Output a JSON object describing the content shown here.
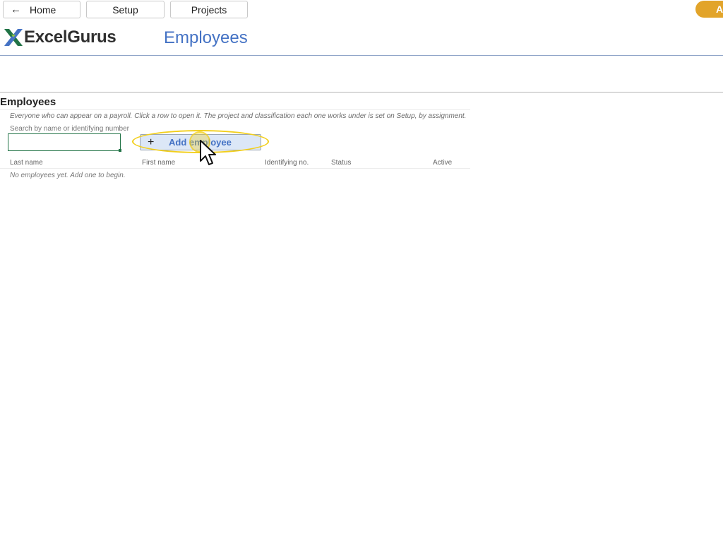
{
  "nav": {
    "home_label": "Home",
    "home_icon": "arrow-left-icon",
    "setup_label": "Setup",
    "projects_label": "Projects",
    "account_initial": "A"
  },
  "header": {
    "logo_text": "ExcelGurus",
    "page_title": "Employees"
  },
  "section": {
    "title": "Employees",
    "description": "Everyone who can appear on a payroll. Click a row to open it. The project and classification each one works under is set on Setup, by assignment.",
    "search_label": "Search by name or identifying number",
    "search_value": "",
    "add_button_label": "Add employee",
    "add_button_icon": "plus-icon"
  },
  "table": {
    "columns": [
      "Last name",
      "First name",
      "Identifying no.",
      "Status",
      "Active"
    ],
    "rows": [],
    "empty_message": "No employees yet. Add one to begin."
  },
  "colors": {
    "accent_blue": "#4472c4",
    "account_orange": "#e2a42a",
    "excel_green": "#217346",
    "highlight_yellow": "#f2cf1d"
  }
}
